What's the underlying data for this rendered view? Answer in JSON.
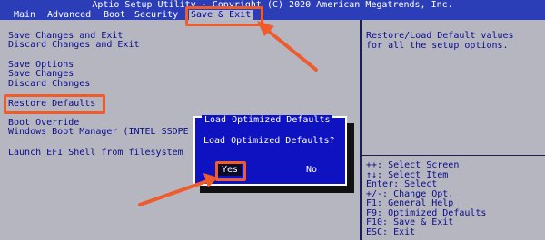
{
  "header": {
    "title": "Aptio Setup Utility - Copyright (C) 2020 American Megatrends, Inc.",
    "tabs": [
      {
        "label": "Main"
      },
      {
        "label": "Advanced"
      },
      {
        "label": "Boot"
      },
      {
        "label": "Security"
      },
      {
        "label": "Save & Exit"
      }
    ]
  },
  "menu": {
    "save_changes_exit": "Save Changes and Exit",
    "discard_changes_exit": "Discard Changes and Exit",
    "save_options": "Save Options",
    "save_changes": "Save Changes",
    "discard_changes": "Discard Changes",
    "restore_defaults": "Restore Defaults",
    "boot_override": "Boot Override",
    "windows_boot_manager": "Windows Boot Manager (INTEL SSDPE",
    "launch_efi_shell": "Launch EFI Shell from filesystem"
  },
  "help": {
    "text_line1": "Restore/Load Default values",
    "text_line2": "for all the setup options."
  },
  "keys": [
    "++: Select Screen",
    "↑↓: Select Item",
    "Enter: Select",
    "+/-: Change Opt.",
    "F1: General Help",
    "F9: Optimized Defaults",
    "F10: Save & Exit",
    "ESC: Exit"
  ],
  "dialog": {
    "title": "Load Optimized Defaults",
    "message": "Load Optimized Defaults?",
    "yes_label": "Yes",
    "no_label": "No"
  },
  "colors": {
    "annotation": "#ef5b2a",
    "bios_blue": "#0000aa",
    "panel_gray": "#b6b6c0"
  }
}
